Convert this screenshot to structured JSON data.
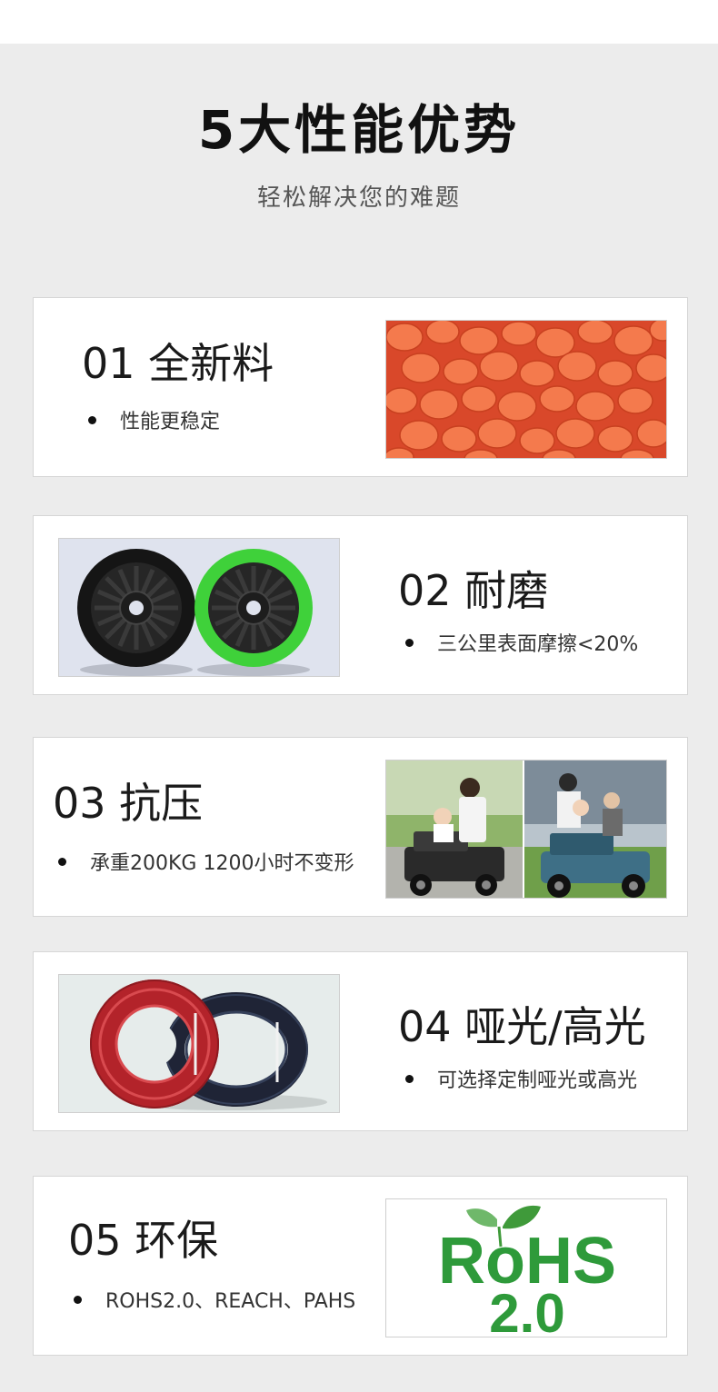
{
  "header": {
    "title": "5大性能优势",
    "subtitle": "轻松解决您的难题"
  },
  "features": [
    {
      "heading": "01 全新料",
      "bullet": "性能更稳定",
      "image": "orange-plastic-pellets"
    },
    {
      "heading": "02 耐磨",
      "bullet": "三公里表面摩擦<20%",
      "image": "black-and-green-wheels"
    },
    {
      "heading": "03 抗压",
      "bullet": "承重200KG 1200小时不变形",
      "image": "kids-ride-on-cars"
    },
    {
      "heading": "04 哑光/高光",
      "bullet": "可选择定制哑光或高光",
      "image": "red-and-black-cable-coils"
    },
    {
      "heading": "05 环保",
      "bullet": "ROHS2.0、REACH、PAHS",
      "image": "rohs-logo"
    }
  ],
  "rohs_logo": {
    "line1": "RoHS",
    "line2": "2.0",
    "color": "#2e9a3a"
  },
  "colors": {
    "background": "#ececec",
    "card": "#ffffff",
    "pellet": "#f0643a",
    "wheel_green": "#3fd13a"
  }
}
